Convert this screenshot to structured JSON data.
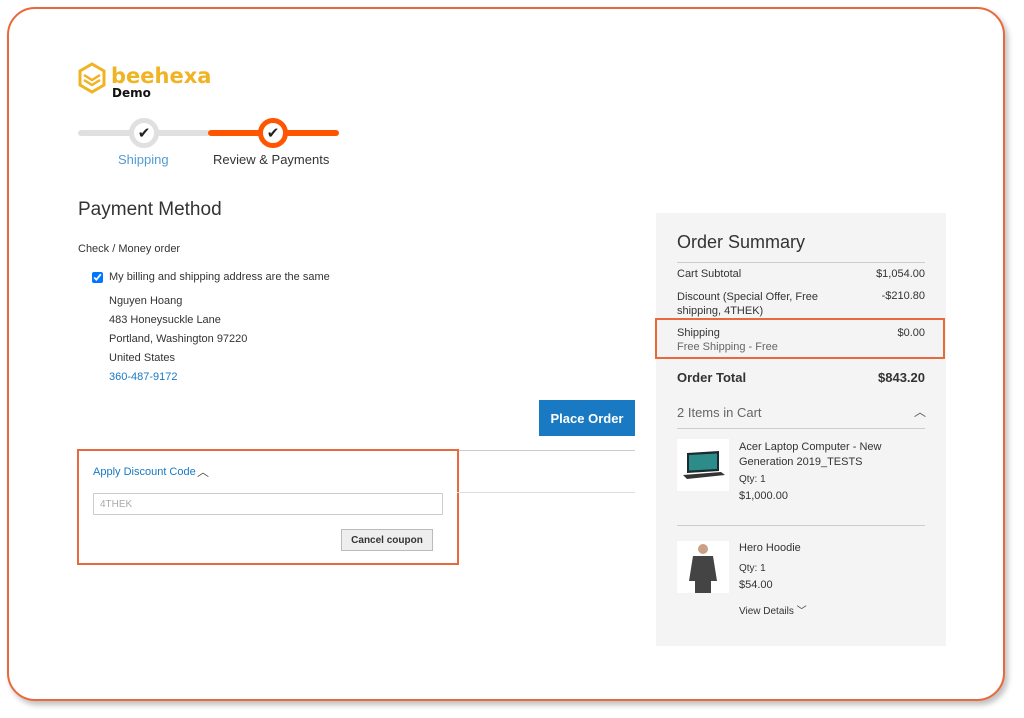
{
  "logo": {
    "name": "beehexa",
    "sub": "Demo"
  },
  "progress": {
    "steps": [
      {
        "label": "Shipping",
        "state": "complete"
      },
      {
        "label": "Review & Payments",
        "state": "active"
      }
    ]
  },
  "payment": {
    "title": "Payment Method",
    "method": "Check / Money order",
    "same_address_label": "My billing and shipping address are the same",
    "same_address_checked": true,
    "address": {
      "name": "Nguyen Hoang",
      "street": "483 Honeysuckle Lane",
      "city": "Portland, Washington 97220",
      "country": "United States",
      "phone": "360-487-9172"
    },
    "place_order": "Place Order"
  },
  "discount": {
    "toggle": "Apply Discount Code",
    "value": "4THEK",
    "cancel": "Cancel coupon"
  },
  "summary": {
    "title": "Order Summary",
    "subtotal_label": "Cart Subtotal",
    "subtotal": "$1,054.00",
    "discount_label": "Discount (Special Offer, Free shipping, 4THEK)",
    "discount": "-$210.80",
    "shipping_label": "Shipping",
    "shipping_method": "Free Shipping - Free",
    "shipping": "$0.00",
    "total_label": "Order Total",
    "total": "$843.20",
    "items_label": "2 Items in Cart",
    "items": [
      {
        "name": "Acer Laptop Computer - New Generation 2019_TESTS",
        "qty": "Qty: 1",
        "price": "$1,000.00"
      },
      {
        "name": "Hero Hoodie",
        "qty": "Qty: 1",
        "price": "$54.00",
        "details": "View Details"
      }
    ]
  },
  "colors": {
    "accent": "#ff5501",
    "link": "#1979c3",
    "highlight": "#e8693c",
    "logo": "#f0b323"
  }
}
